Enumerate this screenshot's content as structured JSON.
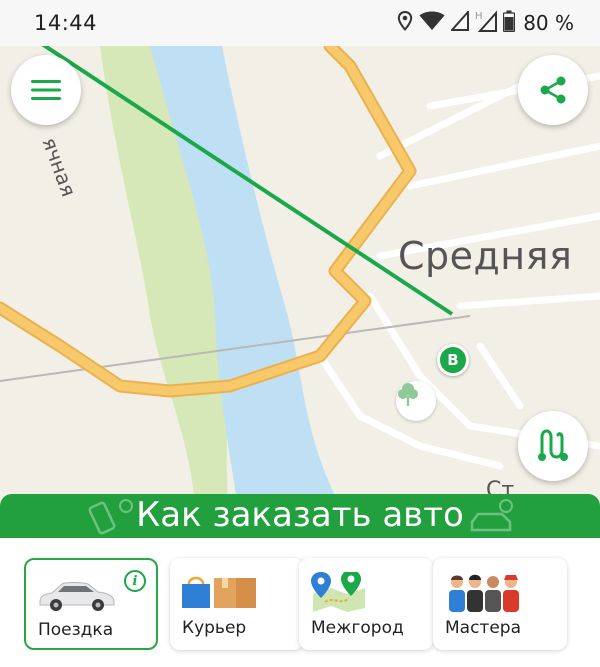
{
  "status_bar": {
    "time": "14:44",
    "battery": "80 %",
    "icons": [
      "location-icon",
      "wifi-icon",
      "signal-icon",
      "signal-h-icon",
      "battery-icon"
    ]
  },
  "map": {
    "labels": {
      "district": "Средняя",
      "street_left": "ячная",
      "street_bottom": "Ст"
    },
    "point_label": "B",
    "colors": {
      "land": "#f1efe6",
      "river": "#bfe0f4",
      "park": "#d6e8b8",
      "road_major": "#f5c463",
      "route": "#1aa84a"
    }
  },
  "banner": {
    "title": "Как заказать авто",
    "color": "#22a03d"
  },
  "services": [
    {
      "label": "Поездка",
      "icon": "car-icon",
      "selected": true
    },
    {
      "label": "Курьер",
      "icon": "courier-boxes-icon",
      "selected": false
    },
    {
      "label": "Межгород",
      "icon": "intercity-map-icon",
      "selected": false
    },
    {
      "label": "Мастера",
      "icon": "masters-people-icon",
      "selected": false
    }
  ],
  "info_badge": "i"
}
